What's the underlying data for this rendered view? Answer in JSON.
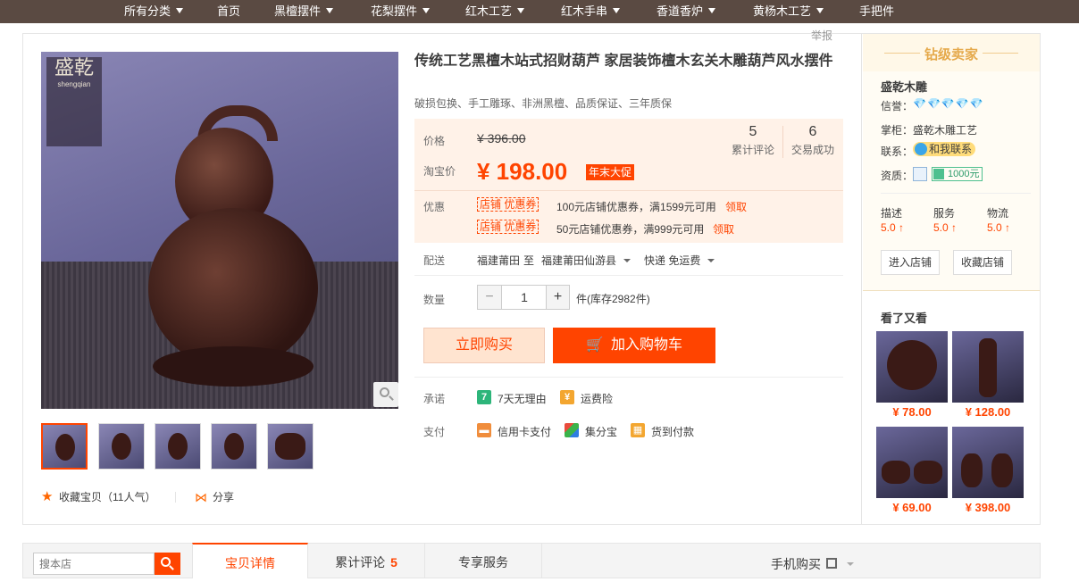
{
  "nav": {
    "items": [
      {
        "label": "所有分类",
        "has_caret": true
      },
      {
        "label": "首页",
        "has_caret": false
      },
      {
        "label": "黑檀摆件",
        "has_caret": true
      },
      {
        "label": "花梨摆件",
        "has_caret": true
      },
      {
        "label": "红木工艺",
        "has_caret": true
      },
      {
        "label": "红木手串",
        "has_caret": true
      },
      {
        "label": "香道香炉",
        "has_caret": true
      },
      {
        "label": "黄杨木工艺",
        "has_caret": true
      },
      {
        "label": "手把件",
        "has_caret": false
      }
    ]
  },
  "report_label": "举报",
  "gallery": {
    "logo_char": "盛乾",
    "logo_sub": "shengqian",
    "thumb_count": 5
  },
  "fav": {
    "label": "收藏宝贝（11人气）",
    "share_label": "分享"
  },
  "product": {
    "title": "传统工艺黑檀木站式招财葫芦 家居装饰檀木玄关木雕葫芦风水摆件",
    "subtitle": "破损包换、手工雕琢、非洲黑檀、品质保证、三年质保"
  },
  "price": {
    "label_price": "价格",
    "original": "¥ 396.00",
    "label_taobao": "淘宝价",
    "current": "¥ 198.00",
    "promo_tag": "年末大促",
    "reviews_count": "5",
    "reviews_label": "累计评论",
    "sales_count": "6",
    "sales_label": "交易成功"
  },
  "coupons": {
    "label": "优惠",
    "items": [
      {
        "tag": "店铺 优惠券",
        "desc": "100元店铺优惠券，满1599元可用",
        "claim": "领取"
      },
      {
        "tag": "店铺 优惠券",
        "desc": "50元店铺优惠券，满999元可用",
        "claim": "领取"
      }
    ]
  },
  "delivery": {
    "label": "配送",
    "from": "福建莆田",
    "to_word": "至",
    "to": "福建莆田仙游县",
    "method": "快递 免运费"
  },
  "quantity": {
    "label": "数量",
    "value": "1",
    "stock": "件(库存2982件)"
  },
  "buttons": {
    "buy_now": "立即购买",
    "add_cart": "加入购物车"
  },
  "promise": {
    "label": "承诺",
    "items": [
      "7天无理由",
      "运费险"
    ]
  },
  "payment": {
    "label": "支付",
    "items": [
      "信用卡支付",
      "集分宝",
      "货到付款"
    ]
  },
  "seller": {
    "level": "钻级卖家",
    "shop_name": "盛乾木雕",
    "credit_label": "信誉：",
    "credit_diamonds": "💎💎💎💎💎",
    "keeper_label": "掌柜：",
    "keeper": "盛乾木雕工艺",
    "contact_label": "联系：",
    "contact_btn": "和我联系",
    "qual_label": "资质：",
    "bond": "1000元",
    "scores": [
      {
        "label": "描述",
        "value": "5.0 ↑"
      },
      {
        "label": "服务",
        "value": "5.0 ↑"
      },
      {
        "label": "物流",
        "value": "5.0 ↑"
      }
    ],
    "enter_shop": "进入店铺",
    "fav_shop": "收藏店铺"
  },
  "also_viewed": {
    "title": "看了又看",
    "items": [
      {
        "price": "¥ 78.00"
      },
      {
        "price": "¥ 128.00"
      },
      {
        "price": "¥ 69.00"
      },
      {
        "price": "¥ 398.00"
      }
    ]
  },
  "bottom": {
    "search_placeholder": "搜本店",
    "tabs": [
      {
        "label": "宝贝详情",
        "count": ""
      },
      {
        "label": "累计评论",
        "count": "5"
      },
      {
        "label": "专享服务",
        "count": ""
      }
    ],
    "mobile_buy": "手机购买"
  },
  "colors": {
    "accent": "#ff4400",
    "nav_bg": "#5a4a42",
    "price_bg": "#fff2e8",
    "seller_gold": "#e5a94b"
  }
}
